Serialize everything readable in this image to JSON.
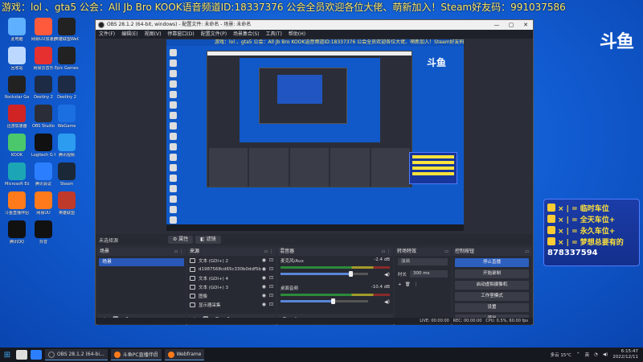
{
  "marquee": "游戏：lol 、gta5 公会：All Jb Bro  KOOK语音频道ID:18337376  公会全员欢迎各位大佬、萌新加入！Steam好友码：991037586",
  "desktop_icons": [
    {
      "label": "此电脑",
      "color": "#5fb0ff"
    },
    {
      "label": "网易UU加速器",
      "color": "#ff5a3c"
    },
    {
      "label": "英雄联盟WeGame版",
      "color": "#222"
    },
    {
      "label": "回收站",
      "color": "#bcd8ff"
    },
    {
      "label": "网易云音乐",
      "color": "#e63030"
    },
    {
      "label": "Epic Games Launcher",
      "color": "#222"
    },
    {
      "label": "Rockstar Games",
      "color": "#222"
    },
    {
      "label": "Destiny 2",
      "color": "#1e2b44"
    },
    {
      "label": "Destiny 2",
      "color": "#1e2b44"
    },
    {
      "label": "迅游加速器",
      "color": "#d02424"
    },
    {
      "label": "OBS Studio",
      "color": "#2b2e38"
    },
    {
      "label": "WeGame",
      "color": "#1c6fe0"
    },
    {
      "label": "KOOK",
      "color": "#4bc86b"
    },
    {
      "label": "Logitech G HUB",
      "color": "#111"
    },
    {
      "label": "腾讯视频",
      "color": "#2c9cf0"
    },
    {
      "label": "Microsoft Edge",
      "color": "#1ca6b5"
    },
    {
      "label": "腾讯会议",
      "color": "#2b7fff"
    },
    {
      "label": "Steam",
      "color": "#1b2838"
    },
    {
      "label": "斗鱼直播伴侣",
      "color": "#ff7a1a"
    },
    {
      "label": "网易UU",
      "color": "#ff7a1a"
    },
    {
      "label": "英雄联盟",
      "color": "#c03a2b"
    },
    {
      "label": "腾讯QQ",
      "color": "#111"
    },
    {
      "label": "抖音",
      "color": "#111"
    }
  ],
  "douyu_logo": "斗鱼",
  "promo": {
    "rows": [
      "× | = 临时车位",
      "× | = 全天车位+",
      "× | = 永久车位+",
      "× | = 梦想总要有的"
    ],
    "qq": "878337594"
  },
  "obs": {
    "title": "OBS 28.1.2 (64-bit, windows) - 配置文件: 未命名 - 场景: 未命名",
    "window_controls": [
      "—",
      "▢",
      "✕"
    ],
    "menu": [
      "文件(F)",
      "编辑(E)",
      "视图(V)",
      "停靠窗口(D)",
      "配置文件(P)",
      "场景集合(S)",
      "工具(T)",
      "帮助(H)"
    ],
    "scene_bar": {
      "no_source": "未选择源",
      "properties": "属性",
      "filters": "滤镜"
    },
    "docks": {
      "scenes": {
        "title": "场景",
        "items": [
          "场景"
        ]
      },
      "sources": {
        "title": "来源",
        "items": [
          "文本 (GDI+) 2",
          "d1987568cd65c330b0ddf5b",
          "文本 (GDI+) 4",
          "文本 (GDI+) 3",
          "图像",
          "显示器采集"
        ]
      },
      "mixer": {
        "title": "混音器",
        "channels": [
          {
            "name": "麦克风/Aux",
            "db": "-2.4 dB",
            "level": 0.8
          },
          {
            "name": "桌面音频",
            "db": "-10.4 dB",
            "level": 0.6
          }
        ]
      },
      "transitions": {
        "title": "转场特效",
        "type": "淡出",
        "duration_label": "时长",
        "duration": "300 ms"
      },
      "controls": {
        "title": "控制按钮",
        "buttons": [
          "停止直播",
          "开始录制",
          "启动虚拟摄像机",
          "工作室模式",
          "设置",
          "退出"
        ]
      }
    },
    "status": {
      "live": "LIVE: 00:00:00",
      "rec": "REC: 00:00:00",
      "cpu": "CPU: 0.5%, 60.00 fps"
    }
  },
  "taskbar": {
    "apps": [
      {
        "label": "OBS 28.1.2 (64-bi...",
        "color": "#2b2e38"
      },
      {
        "label": "斗鱼PC直播伴侣",
        "color": "#ff7a1a"
      },
      {
        "label": "Webframe",
        "color": "#ff7a1a"
      }
    ],
    "weather": "多云 15°C",
    "ime": "英",
    "time": "6:15:47",
    "date": "2022/12/11"
  }
}
